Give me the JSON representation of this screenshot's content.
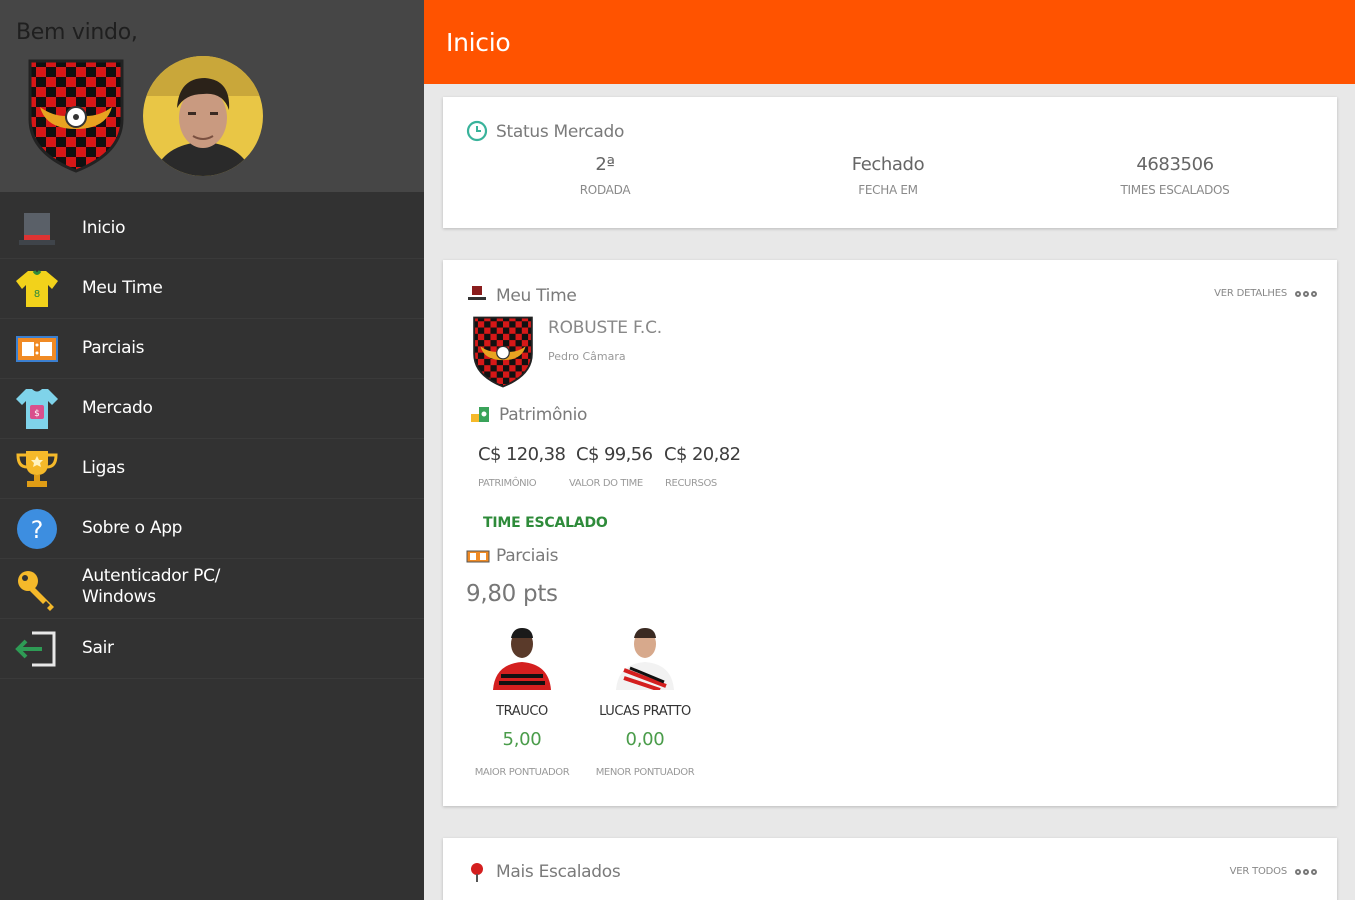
{
  "drawer": {
    "welcome": "Bem vindo,",
    "items": [
      {
        "label": "Inicio",
        "icon": "top-hat-icon"
      },
      {
        "label": "Meu Time",
        "icon": "jersey-icon"
      },
      {
        "label": "Parciais",
        "icon": "scoreboard-icon"
      },
      {
        "label": "Mercado",
        "icon": "shirt-tag-icon"
      },
      {
        "label": "Ligas",
        "icon": "trophy-icon"
      },
      {
        "label": "Sobre o App",
        "icon": "help-icon"
      },
      {
        "label": "Autenticador PC/ Windows",
        "icon": "key-icon"
      },
      {
        "label": "Sair",
        "icon": "logout-icon"
      }
    ]
  },
  "appbar": {
    "title": "Inicio",
    "color": "#ff5300"
  },
  "status": {
    "title": "Status Mercado",
    "rodada": {
      "value": "2ª",
      "label": "RODADA"
    },
    "fecha": {
      "value": "Fechado",
      "label": "FECHA EM"
    },
    "times": {
      "value": "4683506",
      "label": "TIMES ESCALADOS"
    }
  },
  "team": {
    "title": "Meu Time",
    "details_link": "VER DETALHES",
    "name": "ROBUSTE F.C.",
    "owner": "Pedro Câmara",
    "patrimonio_title": "Patrimônio",
    "patrimonio": {
      "value": "C$ 120,38",
      "label": "PATRIMÔNIO"
    },
    "valor_time": {
      "value": "C$ 99,56",
      "label": "VALOR DO TIME"
    },
    "recursos": {
      "value": "C$ 20,82",
      "label": "RECURSOS"
    },
    "status": "TIME ESCALADO",
    "parciais_title": "Parciais",
    "points": "9,80 pts",
    "players": [
      {
        "name": "TRAUCO",
        "score": "5,00",
        "role": "MAIOR PONTUADOR"
      },
      {
        "name": "LUCAS PRATTO",
        "score": "0,00",
        "role": "MENOR PONTUADOR"
      }
    ]
  },
  "most": {
    "title": "Mais Escalados",
    "link": "VER TODOS"
  }
}
